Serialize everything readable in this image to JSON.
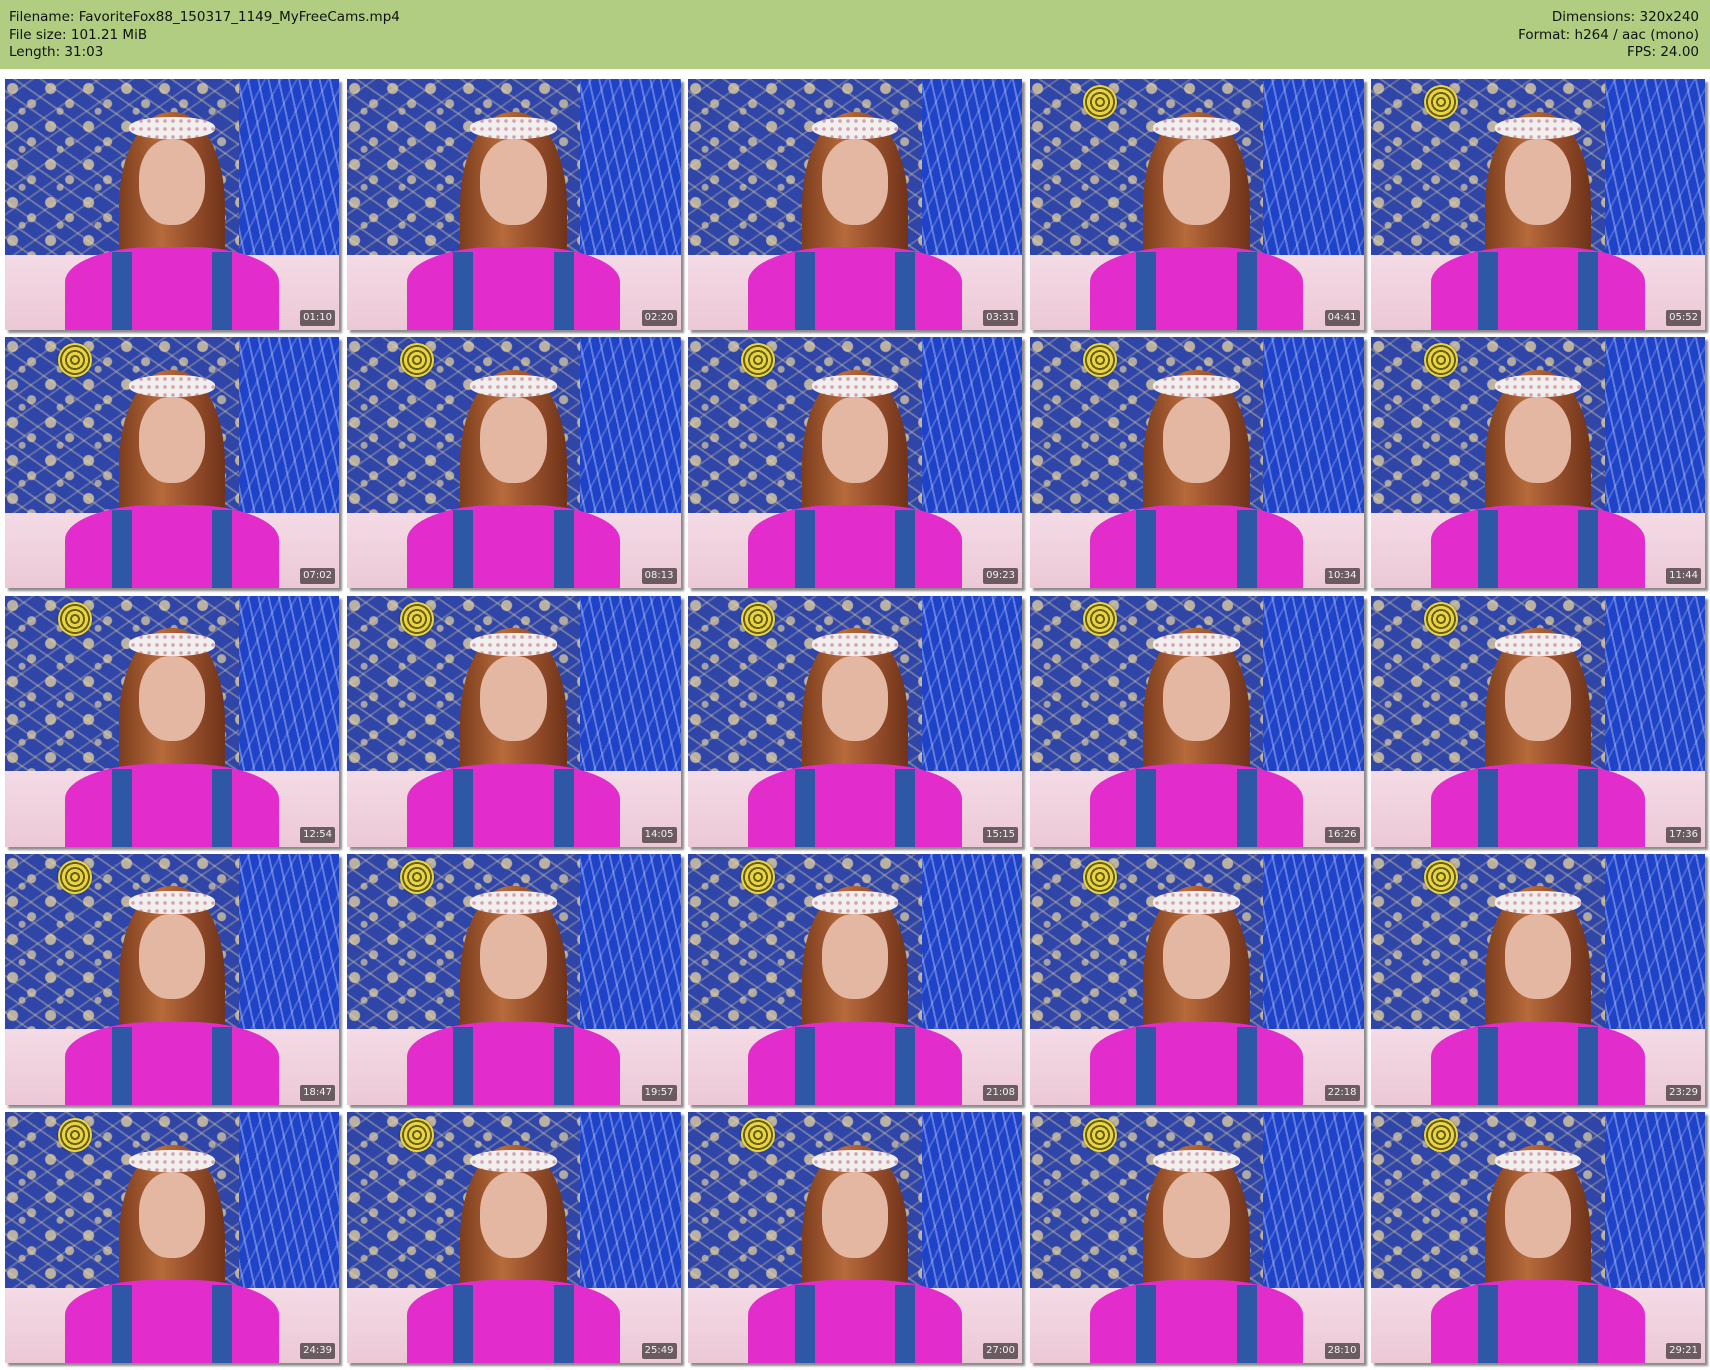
{
  "header": {
    "left": [
      "Filename: FavoriteFox88_150317_1149_MyFreeCams.mp4",
      "File size: 101.21 MiB",
      "Length: 31:03"
    ],
    "right": [
      "Dimensions: 320x240",
      "Format: h264 / aac (mono)",
      "FPS: 24.00"
    ]
  },
  "thumbnails": [
    {
      "time": "01:10",
      "emblem": false
    },
    {
      "time": "02:20",
      "emblem": false
    },
    {
      "time": "03:31",
      "emblem": false
    },
    {
      "time": "04:41",
      "emblem": true
    },
    {
      "time": "05:52",
      "emblem": true
    },
    {
      "time": "07:02",
      "emblem": true
    },
    {
      "time": "08:13",
      "emblem": true
    },
    {
      "time": "09:23",
      "emblem": true
    },
    {
      "time": "10:34",
      "emblem": true
    },
    {
      "time": "11:44",
      "emblem": true
    },
    {
      "time": "12:54",
      "emblem": true
    },
    {
      "time": "14:05",
      "emblem": true
    },
    {
      "time": "15:15",
      "emblem": true
    },
    {
      "time": "16:26",
      "emblem": true
    },
    {
      "time": "17:36",
      "emblem": true
    },
    {
      "time": "18:47",
      "emblem": true
    },
    {
      "time": "19:57",
      "emblem": true
    },
    {
      "time": "21:08",
      "emblem": true
    },
    {
      "time": "22:18",
      "emblem": true
    },
    {
      "time": "23:29",
      "emblem": true
    },
    {
      "time": "24:39",
      "emblem": true
    },
    {
      "time": "25:49",
      "emblem": true
    },
    {
      "time": "27:00",
      "emblem": true
    },
    {
      "time": "28:10",
      "emblem": true
    },
    {
      "time": "29:21",
      "emblem": true
    }
  ],
  "colors": {
    "header_bg": "#b1cd82",
    "wall_blue": "#2f46a8",
    "shirt_pink": "#e32ccc"
  }
}
